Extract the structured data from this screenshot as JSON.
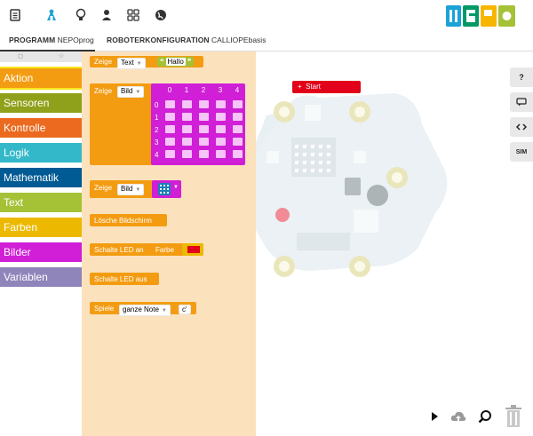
{
  "topbar": {
    "icons": [
      "file-icon",
      "robot-icon",
      "lightbulb-icon",
      "user-icon",
      "gallery-icon",
      "globe-icon"
    ],
    "logo": "nepo-logo"
  },
  "tabs": {
    "program_label": "PROGRAMM",
    "program_name": "NEPOprog",
    "robot_label": "ROBOTERKONFIGURATION",
    "robot_name": "CALLIOPEbasis"
  },
  "toolbox": {
    "header_icons": [
      "expand-icon",
      "star-icon"
    ],
    "categories": [
      {
        "label": "Aktion",
        "color": "#f39c12"
      },
      {
        "label": "Sensoren",
        "color": "#8fa11b"
      },
      {
        "label": "Kontrolle",
        "color": "#eb6a1f"
      },
      {
        "label": "Logik",
        "color": "#33b8ca"
      },
      {
        "label": "Mathematik",
        "color": "#005a94"
      },
      {
        "label": "Text",
        "color": "#a5c236"
      },
      {
        "label": "Farben",
        "color": "#ecb900"
      },
      {
        "label": "Bilder",
        "color": "#d01fd6"
      },
      {
        "label": "Variablen",
        "color": "#9085ba"
      }
    ]
  },
  "flyout": {
    "show_text": {
      "label": "Zeige",
      "type": "Text",
      "value": "Hallo"
    },
    "show_image": {
      "label": "Zeige",
      "type": "Bild",
      "cols": [
        "0",
        "1",
        "2",
        "3",
        "4"
      ],
      "rows": [
        "0",
        "1",
        "2",
        "3",
        "4"
      ]
    },
    "show_image2": {
      "label": "Zeige",
      "type": "Bild"
    },
    "clear_screen": {
      "label": "Lösche Bildschirm"
    },
    "led_on": {
      "label": "Schalte LED an",
      "color_label": "Farbe",
      "color": "#e2001a"
    },
    "led_off": {
      "label": "Schalte LED aus"
    },
    "play_note": {
      "label": "Spiele",
      "duration": "ganze Note",
      "note": "c'"
    }
  },
  "canvas": {
    "start_label": "Start",
    "side_tabs": [
      "?",
      "comment-icon",
      "code-icon",
      "SIM"
    ],
    "bottom_tools": [
      "play-icon",
      "cloud-upload-icon",
      "zoom-icon",
      "trash-icon"
    ]
  }
}
